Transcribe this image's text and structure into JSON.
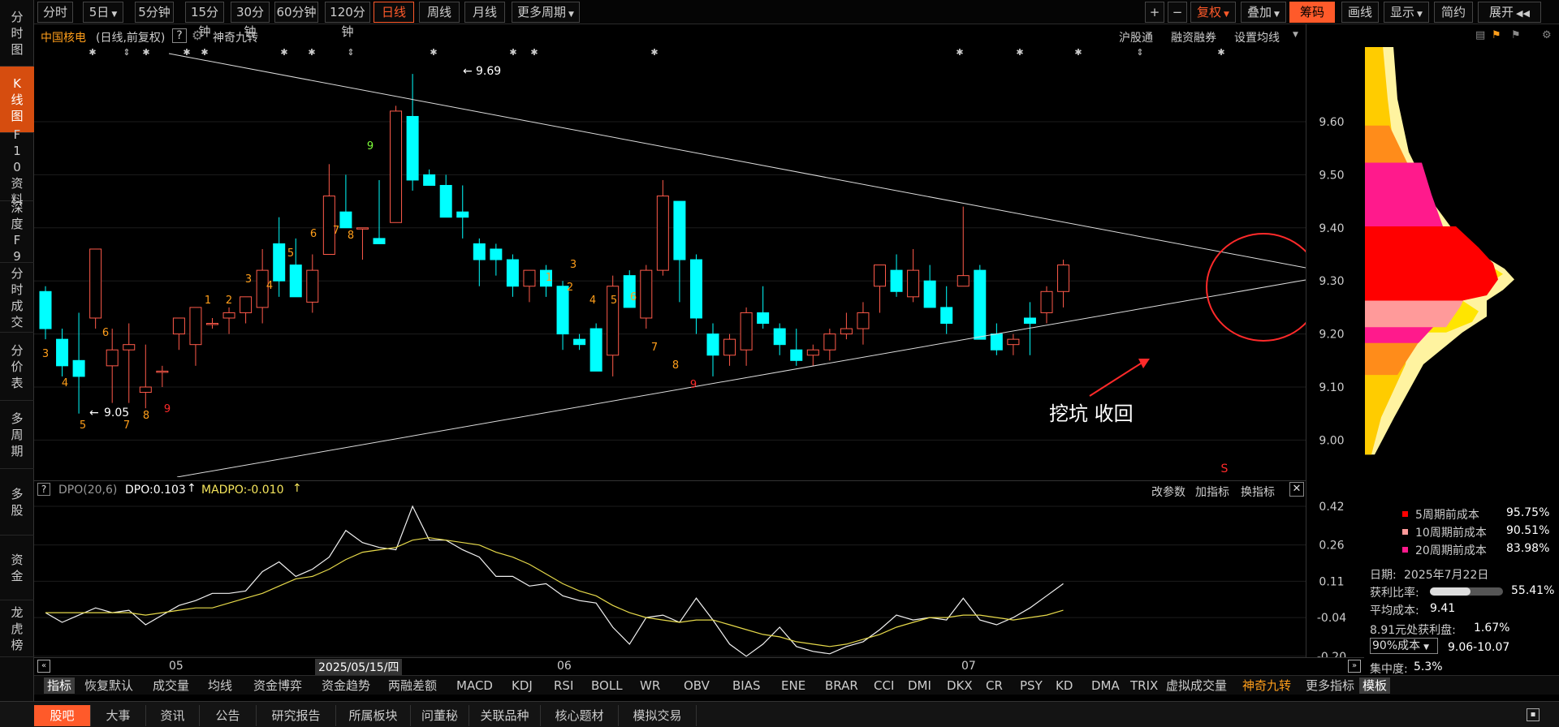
{
  "left_nav": [
    {
      "label": "分时图",
      "active": false
    },
    {
      "label": "K线图",
      "active": true
    },
    {
      "label": "F10资料",
      "active": false
    },
    {
      "label": "深度F9",
      "active": false
    },
    {
      "label": "分时成交",
      "active": false
    },
    {
      "label": "分价表",
      "active": false
    },
    {
      "label": "多周期",
      "active": false
    },
    {
      "label": "多股",
      "active": false
    },
    {
      "label": "资金",
      "active": false
    },
    {
      "label": "龙虎榜",
      "active": false
    }
  ],
  "toolbar": {
    "periods": [
      "分时",
      "5日",
      "5分钟",
      "15分钟",
      "30分钟",
      "60分钟",
      "120分钟",
      "日线",
      "周线",
      "月线",
      "更多周期"
    ],
    "active_period": "日线",
    "right_buttons": [
      "+",
      "−",
      "复权",
      "叠加",
      "筹码",
      "画线",
      "显示",
      "简约",
      "展开"
    ]
  },
  "info": {
    "stock_name": "中国核电",
    "mode": "(日线,前复权)",
    "help": "?",
    "indicator_name": "神奇九转",
    "links": [
      "沪股通",
      "融资融券",
      "设置均线"
    ]
  },
  "main_chart": {
    "price_labels": [
      "9.60",
      "9.50",
      "9.40",
      "9.30",
      "9.20",
      "9.10",
      "9.00"
    ],
    "high_label": "9.69",
    "low_label": "9.05",
    "annotation": "挖坑 收回",
    "red_marker": "S"
  },
  "nine_turn_labels": [
    {
      "t": "3",
      "c": "o"
    },
    {
      "t": "4",
      "c": "o"
    },
    {
      "t": "5",
      "c": "o"
    },
    {
      "t": "6",
      "c": "o"
    },
    {
      "t": "7",
      "c": "o"
    },
    {
      "t": "8",
      "c": "o"
    },
    {
      "t": "9",
      "c": "r"
    },
    {
      "t": "1",
      "c": "o"
    },
    {
      "t": "2",
      "c": "o"
    },
    {
      "t": "3",
      "c": "o"
    },
    {
      "t": "4",
      "c": "o"
    },
    {
      "t": "5",
      "c": "o"
    },
    {
      "t": "6",
      "c": "o"
    },
    {
      "t": "7",
      "c": "o"
    },
    {
      "t": "8",
      "c": "o"
    },
    {
      "t": "9",
      "c": "g"
    },
    {
      "t": "1",
      "c": "o"
    },
    {
      "t": "2",
      "c": "o"
    },
    {
      "t": "3",
      "c": "o"
    },
    {
      "t": "4",
      "c": "o"
    },
    {
      "t": "5",
      "c": "o"
    },
    {
      "t": "6",
      "c": "o"
    },
    {
      "t": "7",
      "c": "o"
    },
    {
      "t": "8",
      "c": "o"
    },
    {
      "t": "9",
      "c": "r"
    }
  ],
  "dpo": {
    "title": "DPO(20,6)",
    "dpo_value": "DPO:0.103",
    "madpo_value": "MADPO:-0.010",
    "actions": [
      "改参数",
      "加指标",
      "换指标"
    ],
    "axis_labels": [
      "0.42",
      "0.26",
      "0.11",
      "-0.04",
      "-0.20"
    ]
  },
  "x_axis": {
    "labels": [
      "05",
      "06",
      "07"
    ],
    "cursor_date": "2025/05/15/四"
  },
  "chip": {
    "legend": [
      {
        "label": "5周期前成本",
        "value": "95.75%",
        "color": "#ff0000"
      },
      {
        "label": "10周期前成本",
        "value": "90.51%",
        "color": "#ff9a9a"
      },
      {
        "label": "20周期前成本",
        "value": "83.98%",
        "color": "#ff1a8c"
      }
    ],
    "date_label": "日期:",
    "date": "2025年7月22日",
    "profit_label": "获利比率:",
    "profit_ratio": 0.5541,
    "profit_text": "55.41%",
    "avg_label": "平均成本:",
    "avg_value": "9.41",
    "profit_at": "8.91元处获利盘:",
    "profit_at_value": "1.67%",
    "cost_select": "90%成本",
    "cost_range": "9.06-10.07",
    "concentration": "集中度:",
    "concentration_value": "5.3%"
  },
  "bottom_tabs": [
    "指标",
    "恢复默认",
    "成交量",
    "均线",
    "资金博弈",
    "资金趋势",
    "两融差额",
    "MACD",
    "KDJ",
    "RSI",
    "BOLL",
    "WR",
    "OBV",
    "BIAS",
    "ENE",
    "BRAR",
    "CCI",
    "DMI",
    "DKX",
    "CR",
    "PSY",
    "KD",
    "DMA",
    "TRIX",
    "虚拟成交量",
    "神奇九转",
    "更多指标",
    "模板"
  ],
  "footer_tabs": [
    "股吧",
    "大事",
    "资讯",
    "公告",
    "研究报告",
    "所属板块",
    "问董秘",
    "关联品种",
    "核心题材",
    "模拟交易"
  ],
  "colors": {
    "up": "#ff5a4a",
    "down": "#00ffff",
    "accent": "#ff5a2a",
    "turn_orange": "#ff9e1a",
    "turn_red": "#ff2a2a",
    "turn_green": "#7dff3a"
  }
}
